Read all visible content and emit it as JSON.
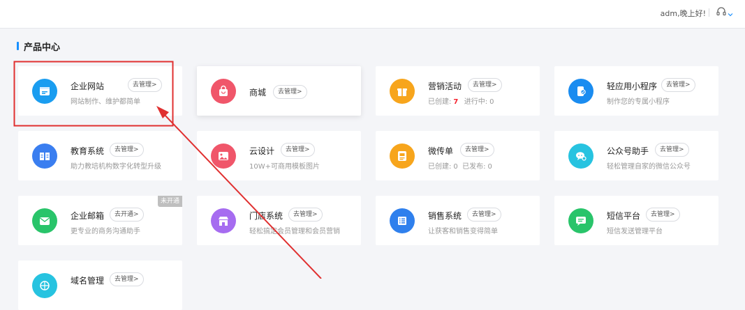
{
  "header": {
    "greeting": "adm,晚上好!",
    "support_icon": "headset-icon",
    "menu_icon": "chevron-down-icon"
  },
  "section": {
    "title": "产品中心"
  },
  "colors": {
    "accent": "#1890ff",
    "annotation": "#e03030"
  },
  "products": [
    {
      "name": "企业网站",
      "manage": "去管理>",
      "desc": "网站制作、维护都简单",
      "icon": "website-icon",
      "color": "#1a9df0"
    },
    {
      "name": "商城",
      "manage": "去管理>",
      "desc": "",
      "icon": "shopping-bag-icon",
      "color": "#f0566a"
    },
    {
      "name": "营销活动",
      "manage": "去管理>",
      "desc_label1": "已创建:",
      "desc_value1": "7",
      "desc_label2": "进行中:",
      "desc_value2": "0",
      "icon": "gift-icon",
      "color": "#f7a51c"
    },
    {
      "name": "轻应用小程序",
      "manage": "去管理>",
      "desc": "制作您的专属小程序",
      "icon": "mini-program-icon",
      "color": "#1a8cf0"
    },
    {
      "name": "教育系统",
      "manage": "去管理>",
      "desc": "助力教培机构数字化转型升级",
      "icon": "book-icon",
      "color": "#3a7ef0"
    },
    {
      "name": "云设计",
      "manage": "去管理>",
      "desc": "10W+可商用模板图片",
      "icon": "image-icon",
      "color": "#f0566a"
    },
    {
      "name": "微传单",
      "manage": "去管理>",
      "desc_label1": "已创建:",
      "desc_value1": "0",
      "desc_label2": "已发布:",
      "desc_value2": "0",
      "icon": "flyer-icon",
      "color": "#f7a51c"
    },
    {
      "name": "公众号助手",
      "manage": "去管理>",
      "desc": "轻松管理自家的微信公众号",
      "icon": "wechat-icon",
      "color": "#27c3e0"
    },
    {
      "name": "企业邮箱",
      "manage": "去开通>",
      "desc": "更专业的商务沟通助手",
      "badge": "未开通",
      "icon": "mail-icon",
      "color": "#29c46a"
    },
    {
      "name": "门店系统",
      "manage": "去管理>",
      "desc": "轻松搞定会员管理和会员营销",
      "icon": "store-icon",
      "color": "#a66cf0"
    },
    {
      "name": "销售系统",
      "manage": "去管理>",
      "desc": "让获客和销售变得简单",
      "icon": "list-icon",
      "color": "#2f80ed"
    },
    {
      "name": "短信平台",
      "manage": "去管理>",
      "desc": "短信发送管理平台",
      "icon": "sms-icon",
      "color": "#29c46a"
    },
    {
      "name": "域名管理",
      "manage": "去管理>",
      "desc": "",
      "icon": "domain-icon",
      "color": "#27c3e0"
    }
  ]
}
